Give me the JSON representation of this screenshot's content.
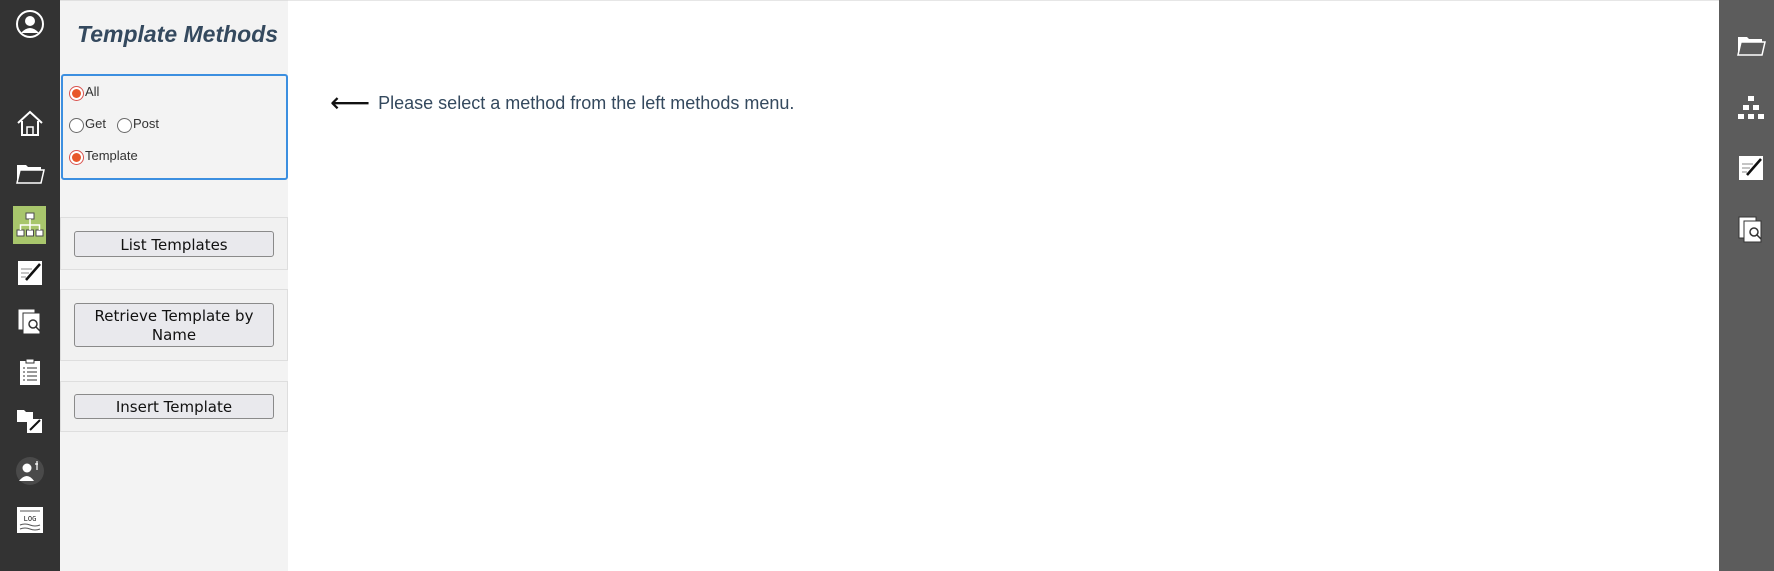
{
  "left_rail": {
    "items": [
      {
        "icon": "user-avatar-icon"
      },
      {
        "icon": "home-icon"
      },
      {
        "icon": "folder-icon"
      },
      {
        "icon": "hierarchy-icon",
        "active": true
      },
      {
        "icon": "edit-document-icon"
      },
      {
        "icon": "search-documents-icon"
      },
      {
        "icon": "checklist-icon"
      },
      {
        "icon": "folder-edit-icon"
      },
      {
        "icon": "user-info-icon"
      },
      {
        "icon": "log-icon"
      }
    ],
    "log_icon_text": "LOG",
    "active_color": "#a8c66c"
  },
  "methods_panel": {
    "title": "Template Methods",
    "filters": {
      "all": {
        "label": "All",
        "checked": true
      },
      "get": {
        "label": "Get",
        "checked": false
      },
      "post": {
        "label": "Post",
        "checked": false
      },
      "template": {
        "label": "Template",
        "checked": true
      }
    },
    "buttons": {
      "list_templates": "List Templates",
      "retrieve_template_line1": "Retrieve Template by",
      "retrieve_template_line2": "Name",
      "insert_template": "Insert Template"
    }
  },
  "main": {
    "hint_arrow": "⟵",
    "hint_text": "Please select a method from the left methods menu."
  },
  "right_rail": {
    "items": [
      {
        "icon": "folder-icon"
      },
      {
        "icon": "hierarchy-icon"
      },
      {
        "icon": "edit-document-icon"
      },
      {
        "icon": "search-documents-icon"
      }
    ]
  },
  "colors": {
    "accent_blue": "#3c8fe0",
    "radio_checked": "#e8572a",
    "title_text": "#34495e",
    "left_rail_bg": "#333333",
    "right_rail_bg": "#5c5c5c"
  }
}
